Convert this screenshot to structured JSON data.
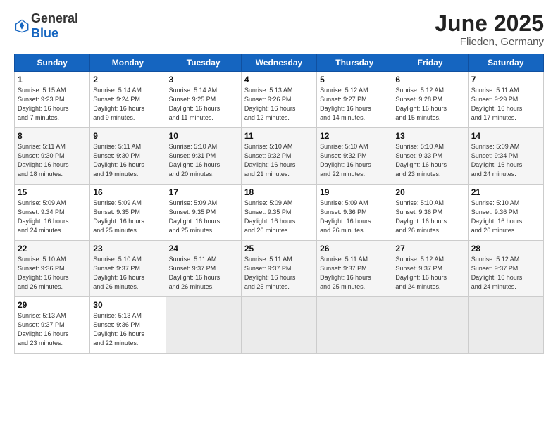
{
  "logo": {
    "general": "General",
    "blue": "Blue"
  },
  "title": "June 2025",
  "subtitle": "Flieden, Germany",
  "weekdays": [
    "Sunday",
    "Monday",
    "Tuesday",
    "Wednesday",
    "Thursday",
    "Friday",
    "Saturday"
  ],
  "weeks": [
    [
      {
        "day": "1",
        "info": "Sunrise: 5:15 AM\nSunset: 9:23 PM\nDaylight: 16 hours\nand 7 minutes."
      },
      {
        "day": "2",
        "info": "Sunrise: 5:14 AM\nSunset: 9:24 PM\nDaylight: 16 hours\nand 9 minutes."
      },
      {
        "day": "3",
        "info": "Sunrise: 5:14 AM\nSunset: 9:25 PM\nDaylight: 16 hours\nand 11 minutes."
      },
      {
        "day": "4",
        "info": "Sunrise: 5:13 AM\nSunset: 9:26 PM\nDaylight: 16 hours\nand 12 minutes."
      },
      {
        "day": "5",
        "info": "Sunrise: 5:12 AM\nSunset: 9:27 PM\nDaylight: 16 hours\nand 14 minutes."
      },
      {
        "day": "6",
        "info": "Sunrise: 5:12 AM\nSunset: 9:28 PM\nDaylight: 16 hours\nand 15 minutes."
      },
      {
        "day": "7",
        "info": "Sunrise: 5:11 AM\nSunset: 9:29 PM\nDaylight: 16 hours\nand 17 minutes."
      }
    ],
    [
      {
        "day": "8",
        "info": "Sunrise: 5:11 AM\nSunset: 9:30 PM\nDaylight: 16 hours\nand 18 minutes."
      },
      {
        "day": "9",
        "info": "Sunrise: 5:11 AM\nSunset: 9:30 PM\nDaylight: 16 hours\nand 19 minutes."
      },
      {
        "day": "10",
        "info": "Sunrise: 5:10 AM\nSunset: 9:31 PM\nDaylight: 16 hours\nand 20 minutes."
      },
      {
        "day": "11",
        "info": "Sunrise: 5:10 AM\nSunset: 9:32 PM\nDaylight: 16 hours\nand 21 minutes."
      },
      {
        "day": "12",
        "info": "Sunrise: 5:10 AM\nSunset: 9:32 PM\nDaylight: 16 hours\nand 22 minutes."
      },
      {
        "day": "13",
        "info": "Sunrise: 5:10 AM\nSunset: 9:33 PM\nDaylight: 16 hours\nand 23 minutes."
      },
      {
        "day": "14",
        "info": "Sunrise: 5:09 AM\nSunset: 9:34 PM\nDaylight: 16 hours\nand 24 minutes."
      }
    ],
    [
      {
        "day": "15",
        "info": "Sunrise: 5:09 AM\nSunset: 9:34 PM\nDaylight: 16 hours\nand 24 minutes."
      },
      {
        "day": "16",
        "info": "Sunrise: 5:09 AM\nSunset: 9:35 PM\nDaylight: 16 hours\nand 25 minutes."
      },
      {
        "day": "17",
        "info": "Sunrise: 5:09 AM\nSunset: 9:35 PM\nDaylight: 16 hours\nand 25 minutes."
      },
      {
        "day": "18",
        "info": "Sunrise: 5:09 AM\nSunset: 9:35 PM\nDaylight: 16 hours\nand 26 minutes."
      },
      {
        "day": "19",
        "info": "Sunrise: 5:09 AM\nSunset: 9:36 PM\nDaylight: 16 hours\nand 26 minutes."
      },
      {
        "day": "20",
        "info": "Sunrise: 5:10 AM\nSunset: 9:36 PM\nDaylight: 16 hours\nand 26 minutes."
      },
      {
        "day": "21",
        "info": "Sunrise: 5:10 AM\nSunset: 9:36 PM\nDaylight: 16 hours\nand 26 minutes."
      }
    ],
    [
      {
        "day": "22",
        "info": "Sunrise: 5:10 AM\nSunset: 9:36 PM\nDaylight: 16 hours\nand 26 minutes."
      },
      {
        "day": "23",
        "info": "Sunrise: 5:10 AM\nSunset: 9:37 PM\nDaylight: 16 hours\nand 26 minutes."
      },
      {
        "day": "24",
        "info": "Sunrise: 5:11 AM\nSunset: 9:37 PM\nDaylight: 16 hours\nand 26 minutes."
      },
      {
        "day": "25",
        "info": "Sunrise: 5:11 AM\nSunset: 9:37 PM\nDaylight: 16 hours\nand 25 minutes."
      },
      {
        "day": "26",
        "info": "Sunrise: 5:11 AM\nSunset: 9:37 PM\nDaylight: 16 hours\nand 25 minutes."
      },
      {
        "day": "27",
        "info": "Sunrise: 5:12 AM\nSunset: 9:37 PM\nDaylight: 16 hours\nand 24 minutes."
      },
      {
        "day": "28",
        "info": "Sunrise: 5:12 AM\nSunset: 9:37 PM\nDaylight: 16 hours\nand 24 minutes."
      }
    ],
    [
      {
        "day": "29",
        "info": "Sunrise: 5:13 AM\nSunset: 9:37 PM\nDaylight: 16 hours\nand 23 minutes."
      },
      {
        "day": "30",
        "info": "Sunrise: 5:13 AM\nSunset: 9:36 PM\nDaylight: 16 hours\nand 22 minutes."
      },
      {
        "day": "",
        "info": ""
      },
      {
        "day": "",
        "info": ""
      },
      {
        "day": "",
        "info": ""
      },
      {
        "day": "",
        "info": ""
      },
      {
        "day": "",
        "info": ""
      }
    ]
  ]
}
